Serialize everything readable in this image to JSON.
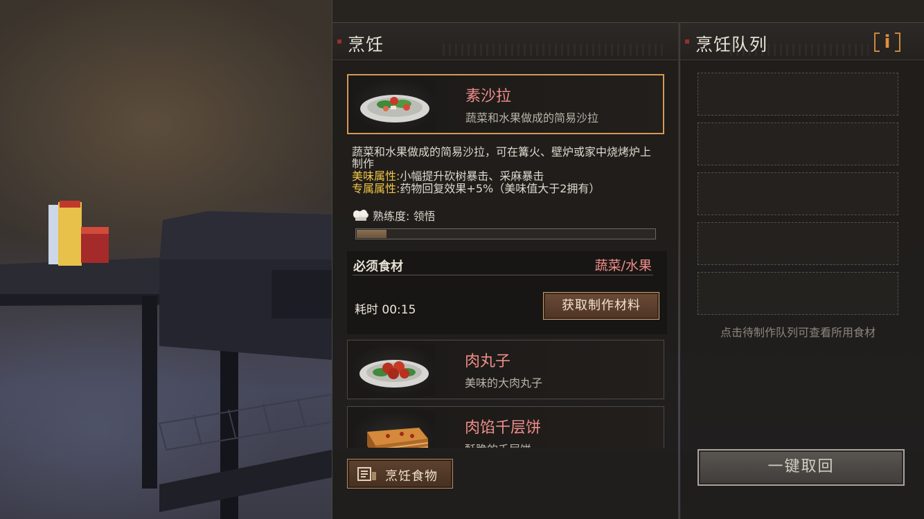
{
  "cooking": {
    "title": "烹饪",
    "selected_recipe": {
      "name": "素沙拉",
      "subtitle": "蔬菜和水果做成的简易沙拉",
      "description": "蔬菜和水果做成的简易沙拉，可在篝火、壁炉或家中烧烤炉上制作",
      "taste_attr_label": "美味属性:",
      "taste_attr_value": "小幅提升砍树暴击、采麻暴击",
      "special_attr_label": "专属属性:",
      "special_attr_value": "药物回复效果+5%（美味值大于2拥有）",
      "mastery_text": "熟练度: 领悟",
      "mastery_progress": 0.1
    },
    "ingredients_label": "必须食材",
    "ingredients_value": "蔬菜/水果",
    "time_text": "耗时 00:15",
    "get_materials_button": "获取制作材料",
    "recipes": [
      {
        "name": "肉丸子",
        "subtitle": "美味的大肉丸子"
      },
      {
        "name": "肉馅千层饼",
        "subtitle": "酥脆的千层饼"
      }
    ],
    "cook_food_button": "烹饪食物"
  },
  "queue": {
    "title": "烹饪队列",
    "info_button": "i",
    "slots": [
      "",
      "",
      "",
      "",
      ""
    ],
    "hint": "点击待制作队列可查看所用食材",
    "recall_button": "一键取回"
  },
  "colors": {
    "accent_orange": "#d79a56",
    "recipe_name_pink": "#f08e8a",
    "attr_yellow": "#f2c646"
  }
}
